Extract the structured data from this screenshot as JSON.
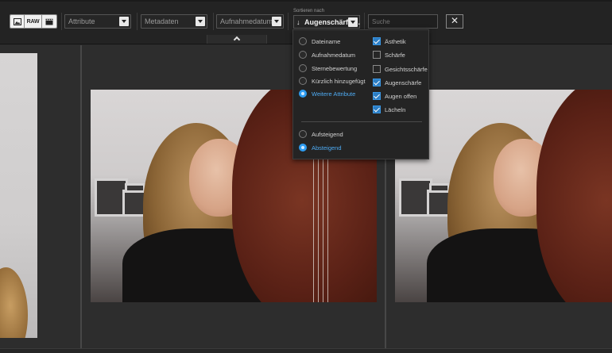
{
  "toolbar": {
    "media_filters": [
      {
        "icon": "image-icon"
      },
      {
        "label": "RAW",
        "icon": "raw-icon"
      },
      {
        "icon": "video-clapper-icon"
      }
    ],
    "attribute_dropdown": "Attribute",
    "metadata_dropdown": "Metadaten",
    "date_dropdown": "Aufnahmedatum",
    "sort": {
      "caption": "Sortieren nach",
      "direction_icon": "arrow-down-icon",
      "value": "Augenschärfe,..."
    },
    "search": {
      "placeholder": "Suche",
      "value": ""
    },
    "close_label": "✕"
  },
  "sort_popup": {
    "sort_fields": [
      {
        "label": "Dateiname",
        "selected": false
      },
      {
        "label": "Aufnahmedatum",
        "selected": false
      },
      {
        "label": "Sternebewertung",
        "selected": false
      },
      {
        "label": "Kürzlich hinzugefügt",
        "selected": false
      },
      {
        "label": "Weitere Attribute",
        "selected": true
      }
    ],
    "attributes": [
      {
        "label": "Ästhetik",
        "checked": true
      },
      {
        "label": "Schärfe",
        "checked": false
      },
      {
        "label": "Gesichtsschärfe",
        "checked": false
      },
      {
        "label": "Augenschärfe",
        "checked": true
      },
      {
        "label": "Augen offen",
        "checked": true
      },
      {
        "label": "Lächeln",
        "checked": true
      }
    ],
    "order": [
      {
        "label": "Aufsteigend",
        "selected": false
      },
      {
        "label": "Absteigend",
        "selected": true
      }
    ]
  },
  "colors": {
    "accent": "#2e9cf0",
    "background": "#2a2a2a",
    "toolbar": "#232323"
  }
}
